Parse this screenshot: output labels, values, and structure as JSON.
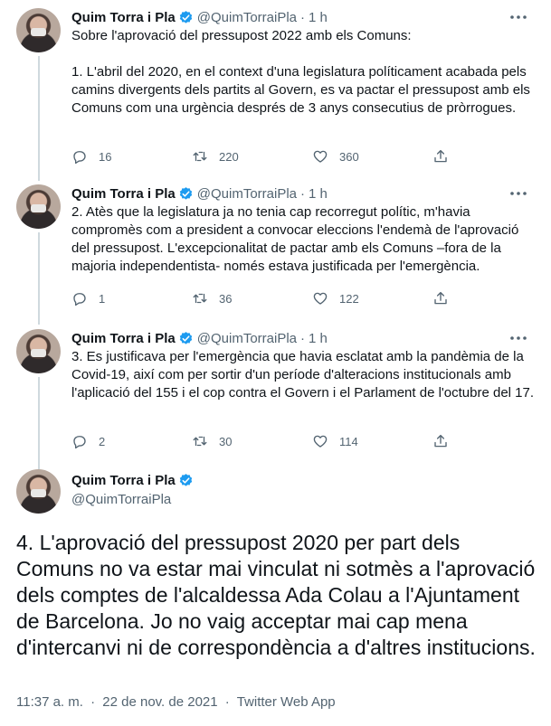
{
  "author": {
    "name": "Quim Torra i Pla",
    "handle": "@QuimTorraiPla"
  },
  "tweets": [
    {
      "time": "1 h",
      "text": "Sobre l'aprovació del pressupost 2022 amb els Comuns:\n\n1. L'abril del 2020, en el context d'una legislatura políticament acabada pels camins divergents dels partits al Govern, es va pactar el pressupost amb els Comuns com una urgència després de 3 anys consecutius de pròrrogues.",
      "replies": "16",
      "retweets": "220",
      "likes": "360"
    },
    {
      "time": "1 h",
      "text": "2. Atès que la legislatura ja no tenia cap recorregut polític, m'havia compromès com a president a convocar eleccions l'endemà de l'aprovació del pressupost. L'excepcionalitat de pactar amb els Comuns –fora de la majoria independentista- només estava justificada per l'emergència.",
      "replies": "1",
      "retweets": "36",
      "likes": "122"
    },
    {
      "time": "1 h",
      "text": "3. Es justificava per l'emergència que havia esclatat amb la pandèmia de la Covid-19, així com per sortir d'un període d'alteracions institucionals amb l'aplicació del 155 i el cop contra el Govern i el Parlament de l'octubre del 17.",
      "replies": "2",
      "retweets": "30",
      "likes": "114"
    }
  ],
  "main_tweet": {
    "text": "4. L'aprovació del pressupost 2020 per part dels Comuns no va estar mai vinculat ni sotmès a l'aprovació dels comptes de l'alcaldessa Ada Colau a l'Ajuntament de Barcelona. Jo no vaig acceptar mai cap mena d'intercanvi ni de correspondència a d'altres institucions.",
    "time": "11:37 a. m.",
    "date": "22 de nov. de 2021",
    "source": "Twitter Web App",
    "separator": "·"
  },
  "colors": {
    "verified": "#1d9bf0",
    "secondary_text": "#536471",
    "thread_line": "#cfd9de"
  },
  "icons": [
    "verified-icon",
    "more-icon",
    "reply-icon",
    "retweet-icon",
    "like-icon",
    "share-icon"
  ]
}
